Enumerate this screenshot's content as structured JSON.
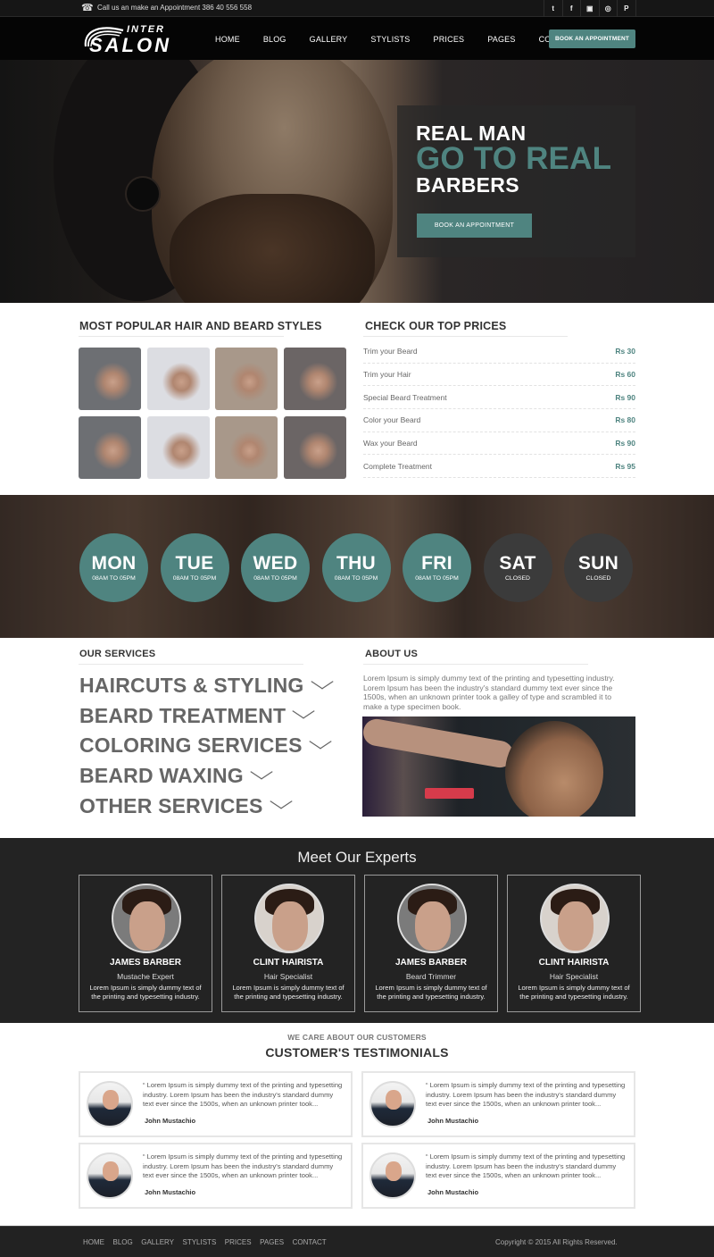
{
  "topbar": {
    "phone_icon": "phone-icon",
    "call_text": "Call us an make an Appointment 386 40 556 558",
    "social": [
      {
        "name": "twitter-icon",
        "glyph": "t"
      },
      {
        "name": "facebook-icon",
        "glyph": "f"
      },
      {
        "name": "instagram-icon",
        "glyph": "▣"
      },
      {
        "name": "dribbble-icon",
        "glyph": "◎"
      },
      {
        "name": "pinterest-icon",
        "glyph": "P"
      }
    ]
  },
  "nav": {
    "logo_top": "INTER",
    "logo_bottom": "SALON",
    "menu": [
      "HOME",
      "BLOG",
      "GALLERY",
      "STYLISTS",
      "PRICES",
      "PAGES",
      "CONTACT"
    ],
    "book_label": "BOOK AN APPOINTMENT"
  },
  "hero": {
    "line1": "REAL MAN",
    "line2": "GO TO REAL",
    "line3": "BARBERS",
    "book_label": "BOOK AN APPOINTMENT"
  },
  "styles": {
    "title": "MOST POPULAR HAIR AND BEARD STYLES",
    "images": [
      {
        "name": "style-photo-1",
        "bg": "#6d6f73"
      },
      {
        "name": "style-photo-2",
        "bg": "#dcdde2"
      },
      {
        "name": "style-photo-3",
        "bg": "#a8988a"
      },
      {
        "name": "style-photo-4",
        "bg": "#6b6565"
      },
      {
        "name": "style-photo-5",
        "bg": "#6d6f73"
      },
      {
        "name": "style-photo-6",
        "bg": "#dcdde2"
      },
      {
        "name": "style-photo-7",
        "bg": "#a8988a"
      },
      {
        "name": "style-photo-8",
        "bg": "#6b6565"
      }
    ]
  },
  "prices": {
    "title": "CHECK OUR TOP PRICES",
    "items": [
      {
        "label": "Trim your Beard",
        "value": "Rs 30"
      },
      {
        "label": "Trim your Hair",
        "value": "Rs 60"
      },
      {
        "label": "Special Beard Treatment",
        "value": "Rs 90"
      },
      {
        "label": "Color your Beard",
        "value": "Rs 80"
      },
      {
        "label": "Wax your Beard",
        "value": "Rs 90"
      },
      {
        "label": "Complete Treatment",
        "value": "Rs 95"
      }
    ]
  },
  "hours": [
    {
      "day": "MON",
      "hours": "08AM TO 05PM",
      "color": "#4f8480"
    },
    {
      "day": "TUE",
      "hours": "08AM TO 05PM",
      "color": "#4f8480"
    },
    {
      "day": "WED",
      "hours": "08AM TO 05PM",
      "color": "#4f8480"
    },
    {
      "day": "THU",
      "hours": "08AM TO 05PM",
      "color": "#4f8480"
    },
    {
      "day": "FRI",
      "hours": "08AM TO 05PM",
      "color": "#4f8480"
    },
    {
      "day": "SAT",
      "hours": "CLOSED",
      "color": "#3b3b3b"
    },
    {
      "day": "SUN",
      "hours": "CLOSED",
      "color": "#3b3b3b"
    }
  ],
  "services": {
    "title": "OUR SERVICES",
    "items": [
      "HAIRCUTS & STYLING",
      "BEARD TREATMENT",
      "COLORING SERVICES",
      "BEARD WAXING",
      "OTHER SERVICES"
    ]
  },
  "about": {
    "title": "ABOUT US",
    "text": "Lorem Ipsum is simply dummy text of the printing and typesetting industry. Lorem Ipsum has been the industry's standard dummy text ever since the 1500s, when an unknown printer took a galley of type and scrambled it to make a type specimen book."
  },
  "experts": {
    "title": "Meet Our Experts",
    "items": [
      {
        "name": "JAMES BARBER",
        "role": "Mustache Expert",
        "desc": "Lorem Ipsum is simply dummy text of the printing and typesetting industry."
      },
      {
        "name": "CLINT HAIRISTA",
        "role": "Hair Specialist",
        "desc": "Lorem Ipsum is simply dummy text of the printing and typesetting industry."
      },
      {
        "name": "JAMES BARBER",
        "role": "Beard Trimmer",
        "desc": "Lorem Ipsum is simply dummy text of the printing and typesetting industry."
      },
      {
        "name": "CLINT HAIRISTA",
        "role": "Hair Specialist",
        "desc": "Lorem Ipsum is simply dummy text of the printing and typesetting industry."
      }
    ]
  },
  "testimonials": {
    "subtitle": "WE CARE ABOUT OUR CUSTOMERS",
    "title": "CUSTOMER'S TESTIMONIALS",
    "items": [
      {
        "quote": "“ Lorem Ipsum is simply dummy text of the printing and typesetting industry. Lorem Ipsum has been the industry's standard dummy text ever since the 1500s, when an unknown printer took...",
        "author": "John Mustachio"
      },
      {
        "quote": "“ Lorem Ipsum is simply dummy text of the printing and typesetting industry. Lorem Ipsum has been the industry's standard dummy text ever since the 1500s, when an unknown printer took...",
        "author": "John Mustachio"
      },
      {
        "quote": "“ Lorem Ipsum is simply dummy text of the printing and typesetting industry. Lorem Ipsum has been the industry's standard dummy text ever since the 1500s, when an unknown printer took...",
        "author": "John Mustachio"
      },
      {
        "quote": "“ Lorem Ipsum is simply dummy text of the printing and typesetting industry. Lorem Ipsum has been the industry's standard dummy text ever since the 1500s, when an unknown printer took...",
        "author": "John Mustachio"
      }
    ]
  },
  "footer": {
    "menu": [
      "HOME",
      "BLOG",
      "GALLERY",
      "STYLISTS",
      "PRICES",
      "PAGES",
      "CONTACT"
    ],
    "copyright": "Copyright © 2015 All Rights Reserved."
  },
  "colors": {
    "accent": "#4f8480",
    "dark": "#232323",
    "closed": "#3b3b3b"
  }
}
